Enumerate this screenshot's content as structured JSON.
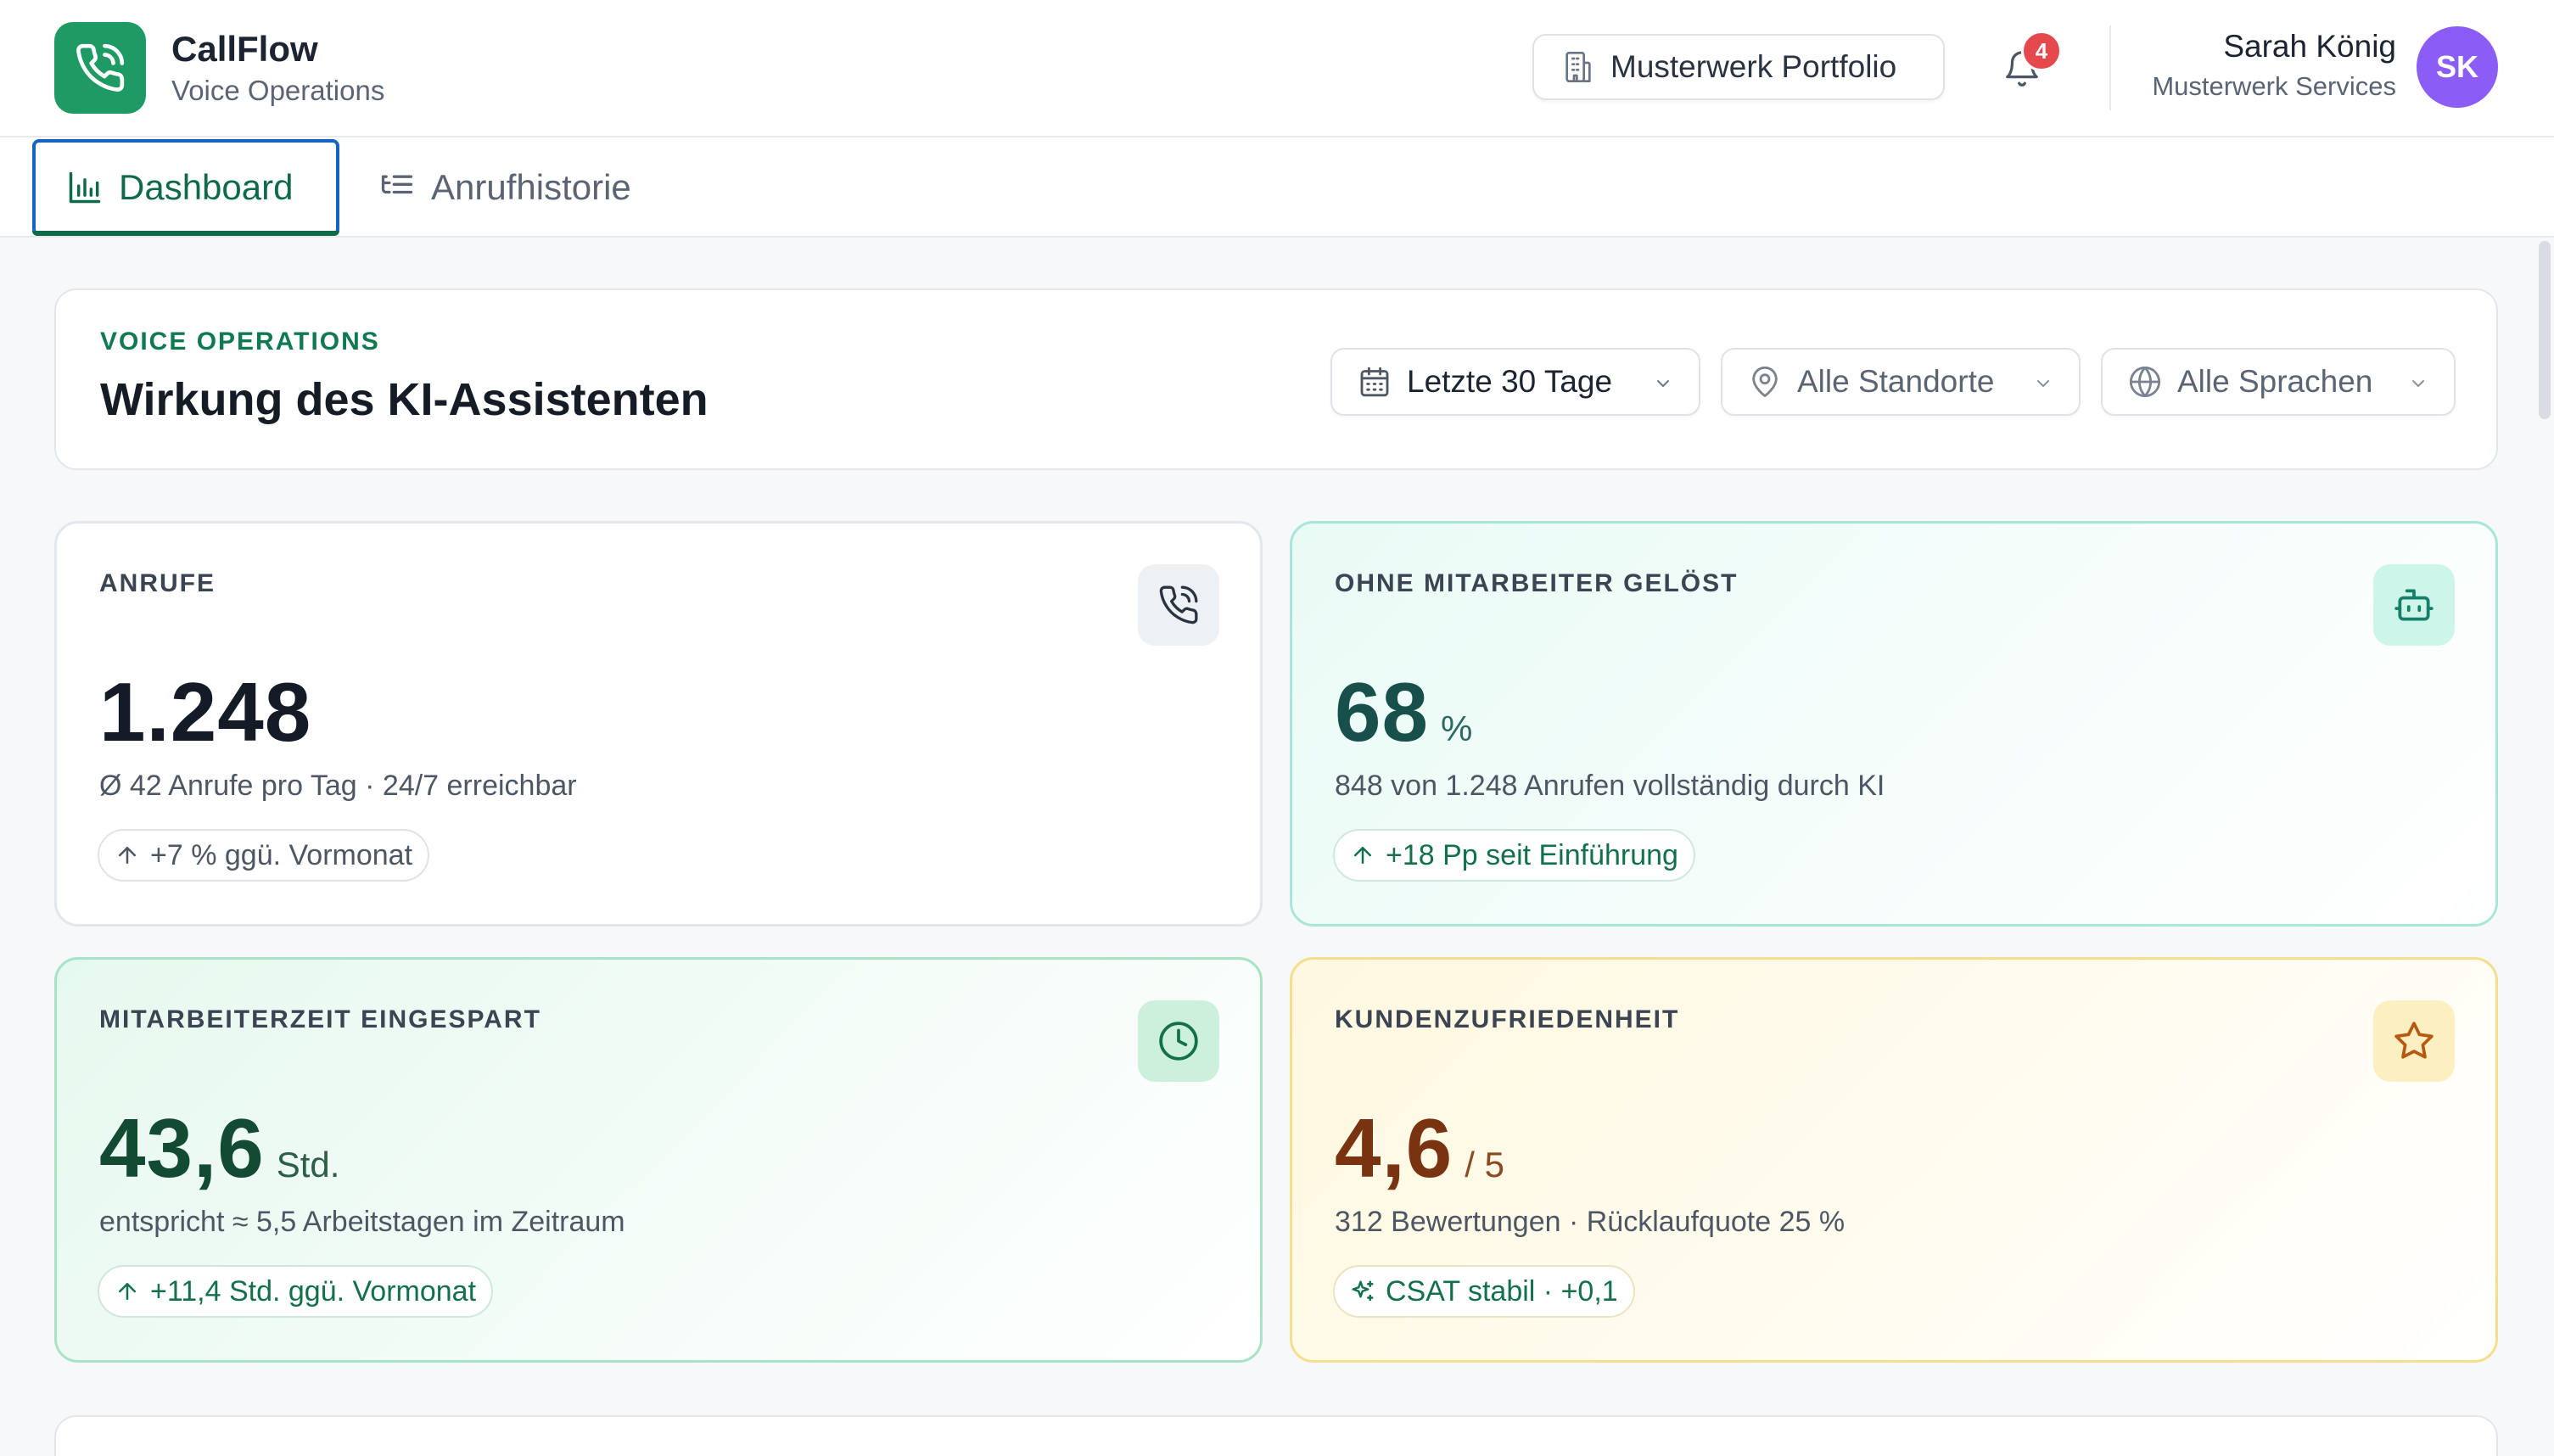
{
  "app": {
    "name": "CallFlow",
    "subtitle": "Voice Operations",
    "logo_icon": "phone-call-icon",
    "brand_color": "#1e9a64"
  },
  "header": {
    "portfolio_label": "Musterwerk Portfolio",
    "portfolio_icon": "building-icon",
    "notification_count": "4",
    "user_name": "Sarah König",
    "user_org": "Musterwerk Services",
    "user_initials": "SK",
    "avatar_color": "#8b5cf6"
  },
  "tabs": [
    {
      "label": "Dashboard",
      "icon": "bar-chart-icon",
      "active": true
    },
    {
      "label": "Anrufhistorie",
      "icon": "list-tree-icon",
      "active": false
    }
  ],
  "filters": {
    "eyebrow": "VOICE OPERATIONS",
    "title": "Wirkung des KI-Assistenten",
    "date_range": "Letzte 30 Tage",
    "location": "Alle Standorte",
    "language": "Alle Sprachen"
  },
  "kpis": {
    "calls": {
      "label": "ANRUFE",
      "value": "1.248",
      "unit": "",
      "description": "Ø 42 Anrufe pro Tag · 24/7 erreichbar",
      "trend": "+7 % ggü. Vormonat",
      "icon": "phone-call-icon"
    },
    "ai_resolved": {
      "label": "OHNE MITARBEITER GELÖST",
      "value": "68",
      "unit": "%",
      "description": "848 von 1.248 Anrufen vollständig durch KI",
      "trend": "+18 Pp seit Einführung",
      "icon": "bot-icon"
    },
    "time_saved": {
      "label": "MITARBEITERZEIT EINGESPART",
      "value": "43,6",
      "unit": "Std.",
      "description": "entspricht ≈ 5,5 Arbeitstagen im Zeitraum",
      "trend": "+11,4 Std. ggü. Vormonat",
      "icon": "clock-icon"
    },
    "csat": {
      "label": "KUNDENZUFRIEDENHEIT",
      "value": "4,6",
      "unit": "/ 5",
      "description": "312 Bewertungen · Rücklaufquote 25 %",
      "trend": "CSAT stabil · +0,1",
      "icon": "star-icon"
    }
  }
}
